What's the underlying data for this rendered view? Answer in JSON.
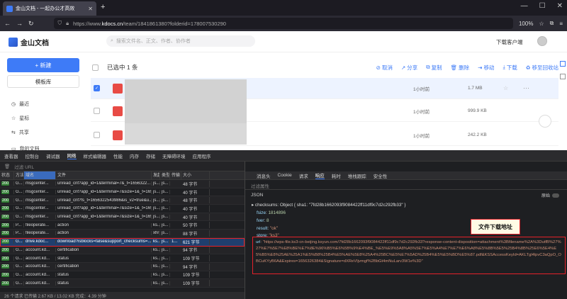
{
  "browser": {
    "tab_title": "金山文档 - 一起办公才高效",
    "url_prefix": "https://www.",
    "url_host": "kdocs.cn",
    "url_path": "/team/1841861380?folderid=178007530290",
    "zoom": "100%"
  },
  "app": {
    "brand": "金山文档",
    "search_placeholder": "搜索文件名、正文、作者、协作者",
    "download_client": "下载客户端",
    "new_button": "+ 新建",
    "template_button": "模板库",
    "sidebar": [
      {
        "icon": "clock-icon",
        "label": "最近"
      },
      {
        "icon": "star-icon",
        "label": "星标"
      },
      {
        "icon": "share-icon",
        "label": "共享"
      },
      {
        "icon": "folder-icon",
        "label": "我的文档"
      }
    ],
    "toolbar": {
      "selected": "已选中 1 条",
      "actions": [
        "取消",
        "分享",
        "复制",
        "删除",
        "移动",
        "下载",
        "移至回收站"
      ]
    },
    "files": [
      {
        "time": "1小时前",
        "size": "1.7 MB",
        "selected": true
      },
      {
        "time": "1小时前",
        "size": "999.9 KB",
        "selected": false
      },
      {
        "time": "1小时前",
        "size": "242.2 KB",
        "selected": false
      }
    ]
  },
  "devtools": {
    "tabs": [
      "查看器",
      "控制台",
      "调试器",
      "网络",
      "样式编辑器",
      "性能",
      "内存",
      "存储",
      "无障碍环境",
      "应用程序"
    ],
    "active_tab": "网络",
    "filter_placeholder": "过滤 URL",
    "columns": [
      "状态",
      "方法",
      "域名",
      "文件",
      "发起者",
      "类型",
      "传输",
      "大小"
    ],
    "rows": [
      {
        "status": "200",
        "method": "G...",
        "domain": "msgcenter...",
        "file": "unread_cnt?app_id=1&terminal=7&_t=1656322...",
        "initiator": "js...",
        "type": "js...",
        "transfer": "",
        "size": "48 字节"
      },
      {
        "status": "200",
        "method": "G...",
        "domain": "msgcenter...",
        "file": "unread_cnt?app_id=1&terminal=7&size=1&_t=165t...",
        "initiator": "js...",
        "type": "js...",
        "transfer": "",
        "size": "40 字节"
      },
      {
        "status": "200",
        "method": "G...",
        "domain": "msgcenter...",
        "file": "unread_cnt?fs_t=1656322543986&is_v2=true&u...",
        "initiator": "js...",
        "type": "js...",
        "transfer": "",
        "size": "48 字节"
      },
      {
        "status": "200",
        "method": "G...",
        "domain": "msgcenter...",
        "file": "unread_cnt?app_id=1&terminal=7&size=1&_t=165t...",
        "initiator": "js...",
        "type": "js...",
        "transfer": "",
        "size": "40 字节"
      },
      {
        "status": "200",
        "method": "G...",
        "domain": "msgcenter...",
        "file": "unread_cnt?app_id=1&terminal=7&size=1&_t=165t...",
        "initiator": "js...",
        "type": "js...",
        "transfer": "",
        "size": "40 字节"
      },
      {
        "status": "200",
        "method": "P...",
        "domain": "fileoperate...",
        "file": "action",
        "initiator": "ks...",
        "type": "js...",
        "transfer": "",
        "size": "50 字节"
      },
      {
        "status": "200",
        "method": "P...",
        "domain": "fileoperate...",
        "file": "action",
        "initiator": "xhr",
        "type": "js...",
        "transfer": "",
        "size": "88 字节"
      },
      {
        "status": "200",
        "method": "G...",
        "domain": "drive.kdoc...",
        "file": "download?isblocks=false&support_checksums=...",
        "initiator": "ks...",
        "type": "js...",
        "transfer": "1...",
        "size": "621 字节",
        "highlight": true
      },
      {
        "status": "200",
        "method": "G...",
        "domain": "account.kd...",
        "file": "certification",
        "initiator": "ks...",
        "type": "js...",
        "transfer": "",
        "size": "94 字节"
      },
      {
        "status": "200",
        "method": "G...",
        "domain": "account.kd...",
        "file": "status",
        "initiator": "ks...",
        "type": "js...",
        "transfer": "",
        "size": "109 字节"
      },
      {
        "status": "200",
        "method": "G...",
        "domain": "account.kd...",
        "file": "certification",
        "initiator": "ks...",
        "type": "js...",
        "transfer": "",
        "size": "94 字节"
      },
      {
        "status": "200",
        "method": "G...",
        "domain": "account.kd...",
        "file": "status",
        "initiator": "ks...",
        "type": "js...",
        "transfer": "",
        "size": "109 字节"
      },
      {
        "status": "200",
        "method": "G...",
        "domain": "account.kd...",
        "file": "status",
        "initiator": "ks...",
        "type": "js...",
        "transfer": "",
        "size": "109 字节"
      }
    ],
    "statusbar": "26 个请求    已传输 2.67 KB / 13.02 KB    完成：4.39 分钟",
    "detail_tabs": [
      "消息头",
      "Cookie",
      "请求",
      "响应",
      "耗时",
      "堆栈跟踪",
      "安全性"
    ],
    "detail_active": "响应",
    "detail_filter": "过滤属性",
    "json_label": "JSON",
    "raw_label": "原始",
    "json": {
      "checksums_line": "checksums: Object { sha1: \"7fd28b1662093f9084422ff11df9c7d2c292fb33\" }",
      "fsize_key": "fsize",
      "fsize_val": "1814896",
      "fver_key": "fver",
      "fver_val": "8",
      "result_key": "result",
      "result_val": "\"ok\"",
      "store_key": "store",
      "store_val": "\"ks3\"",
      "url_key": "url",
      "url_val": "\"https://wps-file.ks3-cn-beijing.ksyun.com/7fd28b1662093f9084422ff11df9c7d2c292fb33?response-content-disposition=attachment%3Bfilename%2A%3DutfB%27%27%E7%5E7%E8%BE%E7%8E%96%B5%E6%5B%9%E4%BE_%E5%E9%5A8%A5%5E7%E5%A4%E7%E7%E6%A8%E5%8B%5E5%25B4%8B%25E6%5E4%E5%B5%E8%25AE%25A1%E5%B8%25B4%E5%AE%5E8%25A4%25BC%E5%E7%5AD%25B4%E5%E5%BD%E5%87.pdf&KSSAccessKeyId=AKLTgl4lpvC3aQpO_OBCuKYyB6A&Expires=1656326384&Signature=dXReVIjvmgf%2BbGt4mNuLarv3W1e%3D\""
    },
    "annotation": "文件下载地址"
  }
}
